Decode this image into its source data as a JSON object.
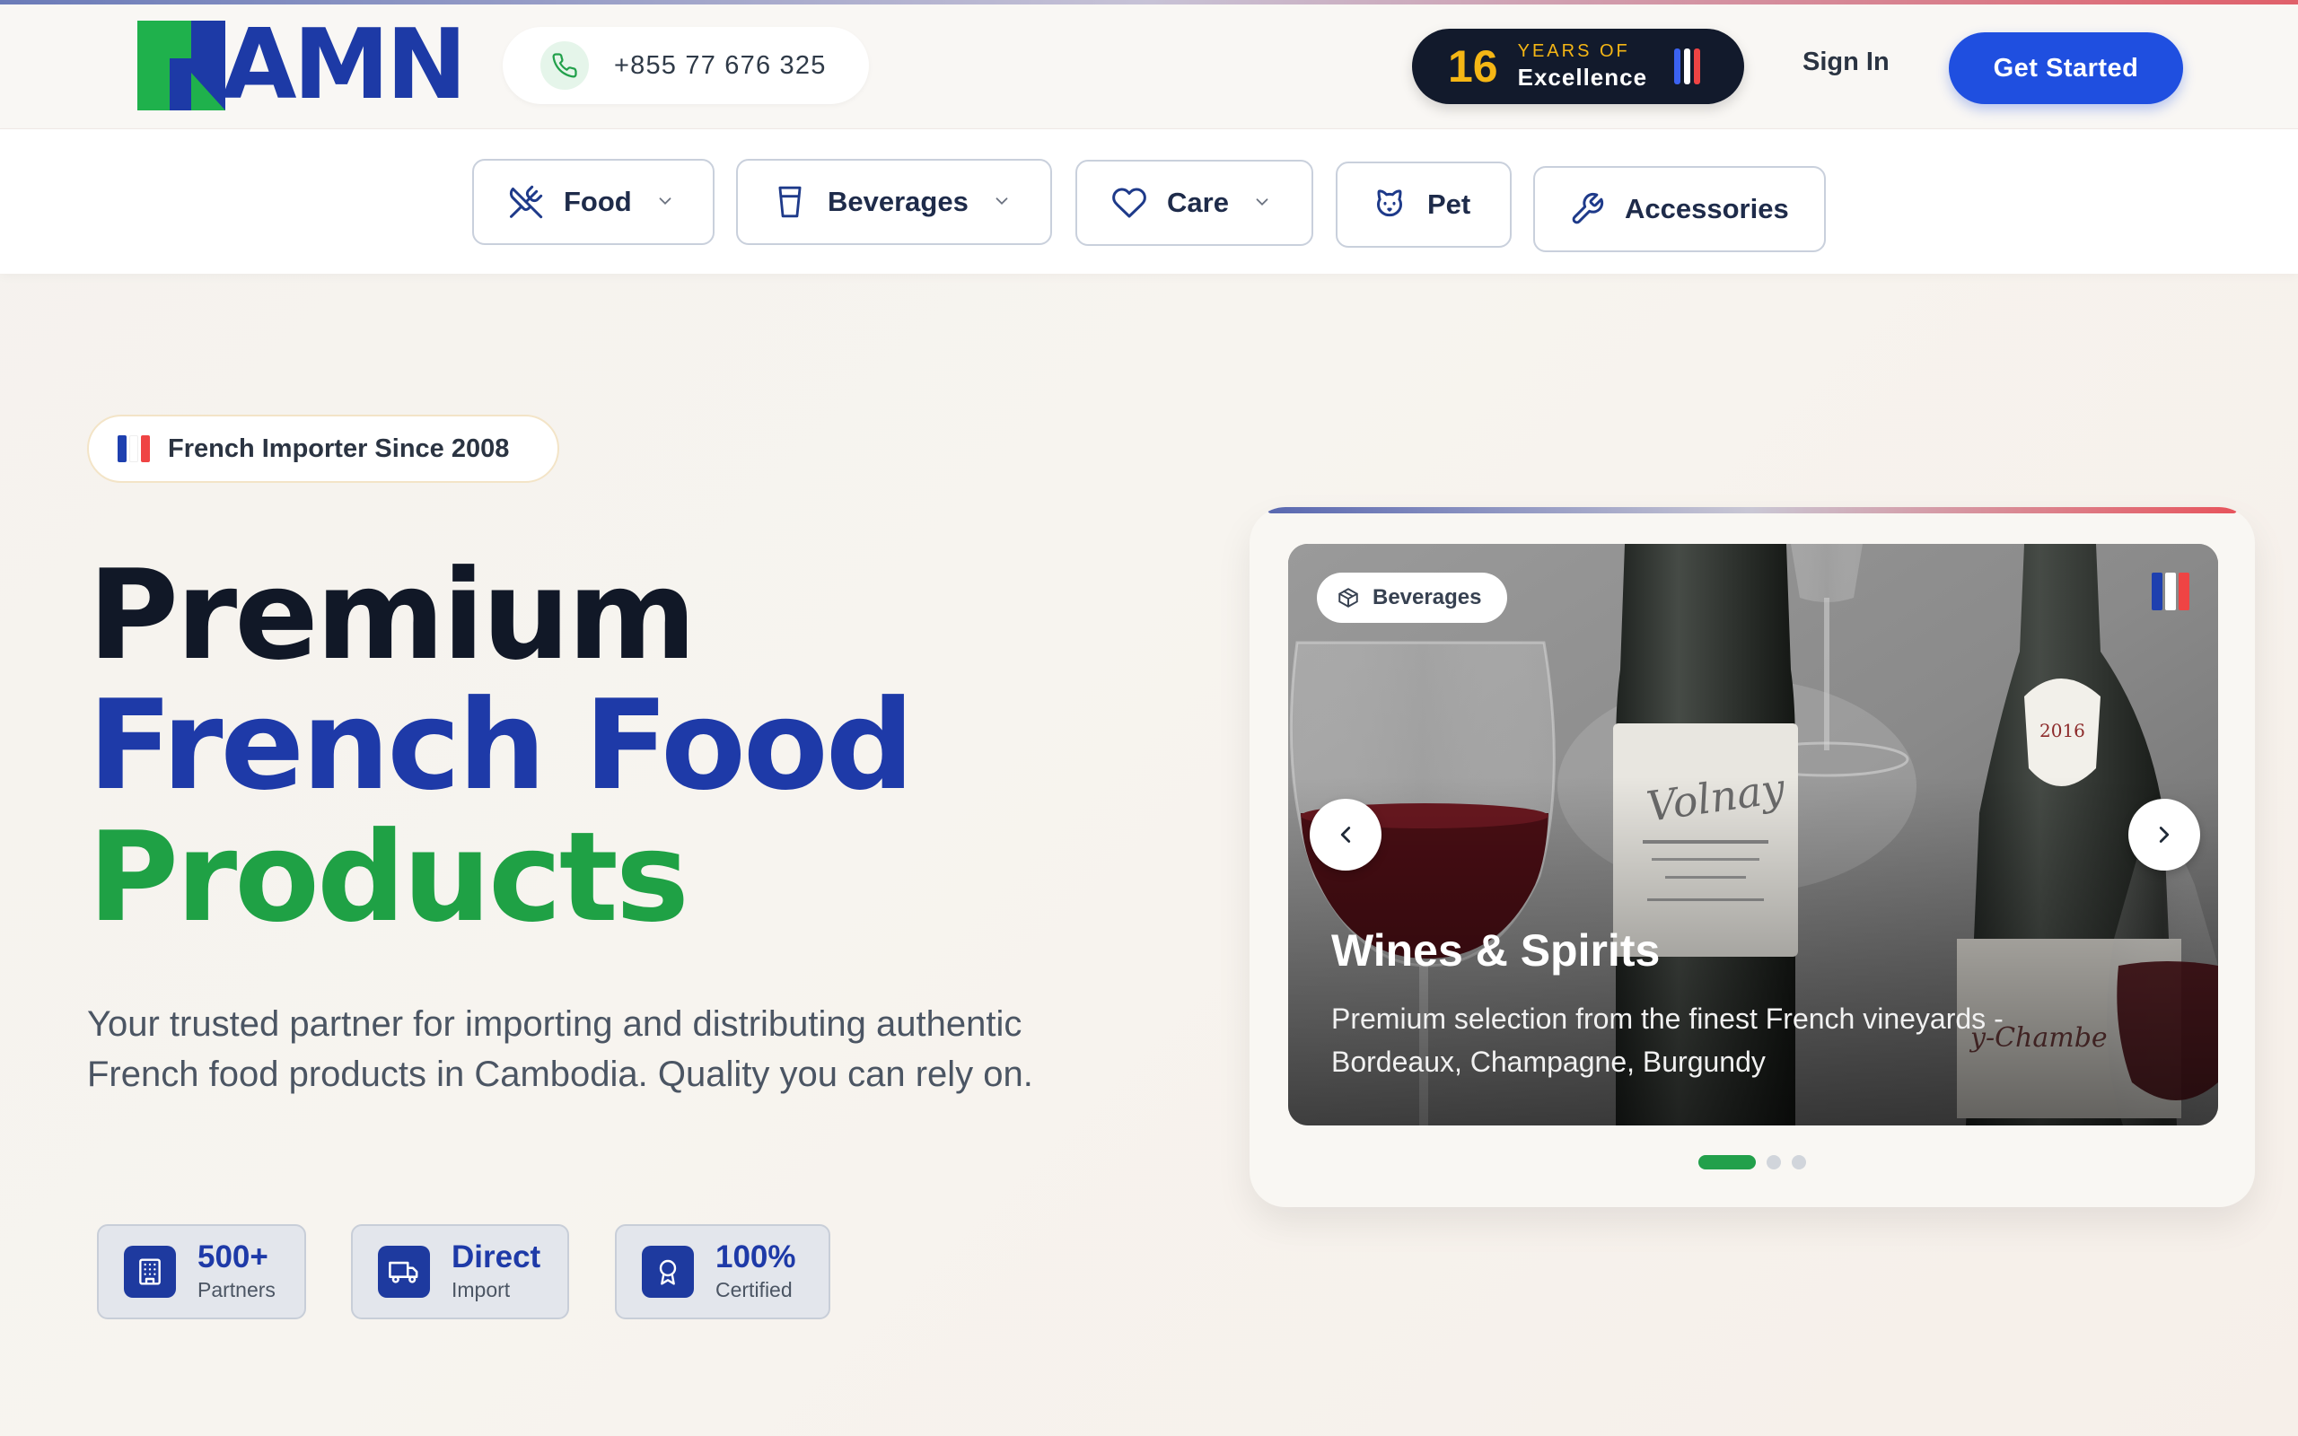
{
  "brand": {
    "logo_text": "AMN",
    "logo_color": "#1d3aa6",
    "mark_color": "#1fb14c"
  },
  "header": {
    "phone": "+855 77 676 325",
    "years_number": "16",
    "years_top": "YEARS OF",
    "years_bottom": "Excellence",
    "sign_in_label": "Sign In",
    "get_started_label": "Get Started"
  },
  "nav": {
    "categories": [
      {
        "label": "Food",
        "icon": "utensils-icon",
        "has_dropdown": true
      },
      {
        "label": "Beverages",
        "icon": "cup-icon",
        "has_dropdown": true
      },
      {
        "label": "Care",
        "icon": "heart-icon",
        "has_dropdown": true
      },
      {
        "label": "Pet",
        "icon": "cat-icon",
        "has_dropdown": false
      },
      {
        "label": "Accessories",
        "icon": "wrench-icon",
        "has_dropdown": false
      }
    ]
  },
  "hero": {
    "badge": "French Importer Since 2008",
    "title_line1": "Premium",
    "title_line2": "French Food",
    "title_line3": "Products",
    "description": "Your trusted partner for importing and distributing authentic French food products in Cambodia. Quality you can rely on.",
    "stats": [
      {
        "value": "500+",
        "label": "Partners",
        "icon": "building-icon"
      },
      {
        "value": "Direct",
        "label": "Import",
        "icon": "truck-icon"
      },
      {
        "value": "100%",
        "label": "Certified",
        "icon": "award-icon"
      }
    ]
  },
  "carousel": {
    "category_badge": "Beverages",
    "slide_title": "Wines & Spirits",
    "slide_description": "Premium selection from the finest French vineyards - Bordeaux, Champagne, Burgundy",
    "slide_count": 3,
    "active_index": 0
  },
  "colors": {
    "primary_blue": "#1f4fe0",
    "brand_green": "#1fa145",
    "flag_blue": "#1e40af",
    "flag_red": "#ef4444",
    "gold": "#f5b615"
  }
}
